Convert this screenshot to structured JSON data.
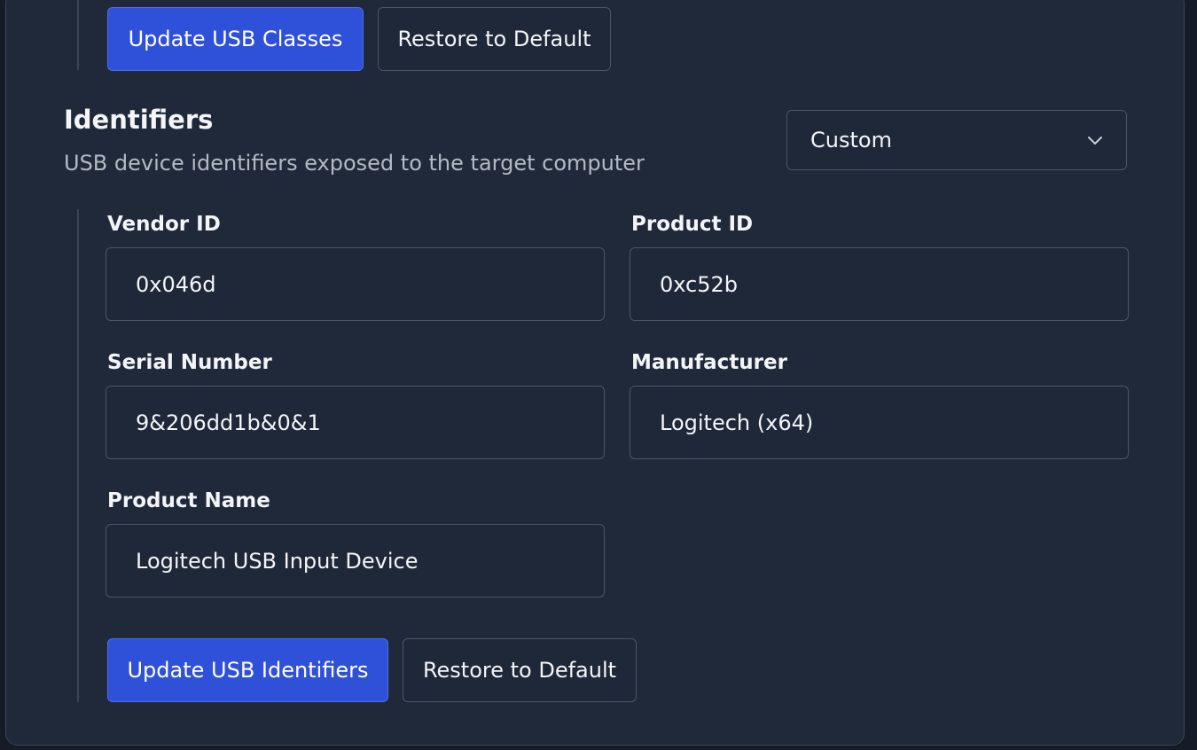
{
  "usb_classes": {
    "update_label": "Update USB Classes",
    "restore_label": "Restore to Default"
  },
  "identifiers": {
    "title": "Identifiers",
    "description": "USB device identifiers exposed to the target computer",
    "preset": {
      "selected": "Custom",
      "icon": "chevron-down-icon"
    },
    "fields": {
      "vendor_id": {
        "label": "Vendor ID",
        "value": "0x046d"
      },
      "product_id": {
        "label": "Product ID",
        "value": "0xc52b"
      },
      "serial_number": {
        "label": "Serial Number",
        "value": "9&206dd1b&0&1"
      },
      "manufacturer": {
        "label": "Manufacturer",
        "value": "Logitech (x64)"
      },
      "product_name": {
        "label": "Product Name",
        "value": "Logitech USB Input Device"
      }
    },
    "update_label": "Update USB Identifiers",
    "restore_label": "Restore to Default"
  },
  "colors": {
    "panel_bg": "#202939",
    "primary": "#2f50d9",
    "border": "#4a5566",
    "muted_text": "#b3bac6"
  }
}
